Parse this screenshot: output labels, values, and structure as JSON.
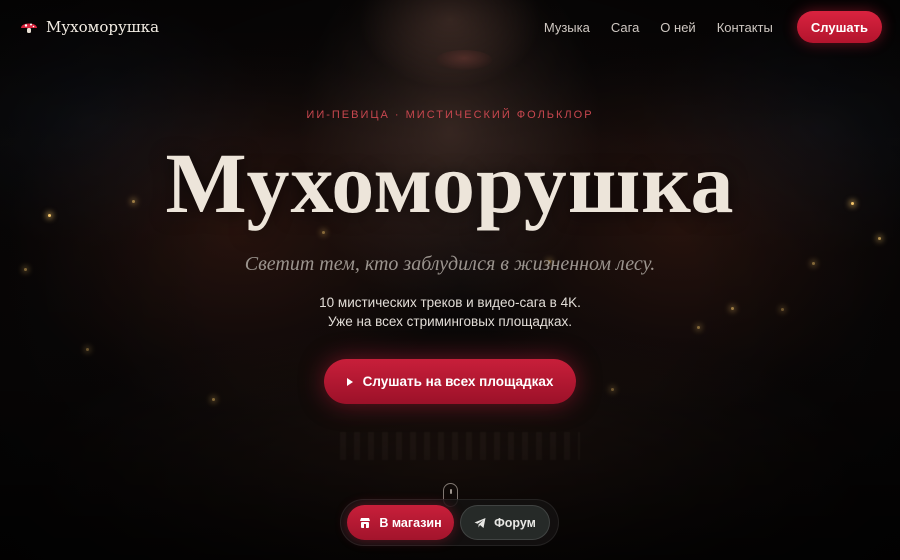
{
  "brand": {
    "name": "Мухоморушка",
    "logo_icon": "mushroom-icon"
  },
  "nav": {
    "links": [
      {
        "label": "Музыка"
      },
      {
        "label": "Сага"
      },
      {
        "label": "О ней"
      },
      {
        "label": "Контакты"
      }
    ],
    "cta_label": "Слушать"
  },
  "hero": {
    "eyebrow": "ИИ-ПЕВИЦА · МИСТИЧЕСКИЙ ФОЛЬКЛОР",
    "title": "Мухоморушка",
    "tagline": "Светит тем, кто заблудился в жизненном лесу.",
    "desc_line1": "10 мистических треков и видео-сага в 4K.",
    "desc_line2": "Уже на всех стриминговых площадках.",
    "cta_label": "Слушать на всех площадках",
    "cta_icon": "play-icon"
  },
  "dock": {
    "shop_label": "В магазин",
    "shop_icon": "shop-icon",
    "forum_label": "Форум",
    "forum_icon": "telegram-icon"
  },
  "colors": {
    "accent": "#c81f3a",
    "eyebrow": "#c8474f",
    "title": "#ede5da",
    "tagline": "#9b948e",
    "background": "#0b0809"
  }
}
